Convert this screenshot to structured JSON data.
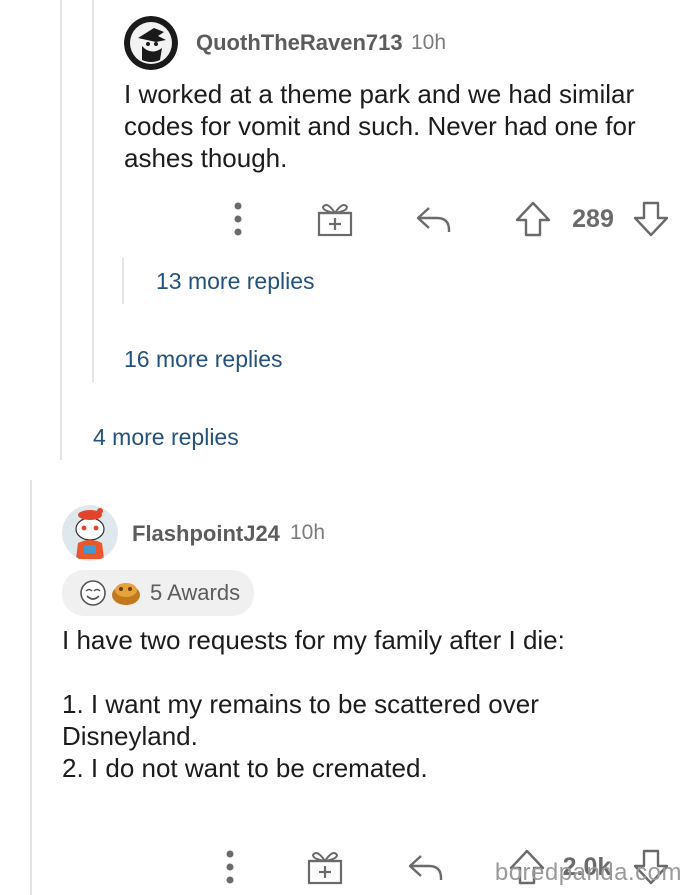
{
  "comment1": {
    "username": "QuothTheRaven713",
    "time": "10h",
    "lines": [
      "I worked at a theme park and we had similar",
      "codes for vomit and such. Never had one for",
      "ashes though."
    ],
    "votes": "289"
  },
  "more_replies": {
    "inner": "13 more replies",
    "middle": "16 more replies",
    "outer": "4 more replies"
  },
  "comment2": {
    "username": "FlashpointJ24",
    "time": "10h",
    "awards": "5 Awards",
    "lines": [
      "I have two requests for my family after I die:",
      "",
      "1. I want my remains to be scattered over",
      "Disneyland.",
      "2. I do not want to be cremated."
    ],
    "votes": "2.0k"
  },
  "watermark": "boredpanda.com",
  "icons": {
    "more": "more-options-icon",
    "award": "gift-award-icon",
    "reply": "reply-arrow-icon",
    "upvote": "upvote-arrow-icon",
    "downvote": "downvote-arrow-icon"
  }
}
